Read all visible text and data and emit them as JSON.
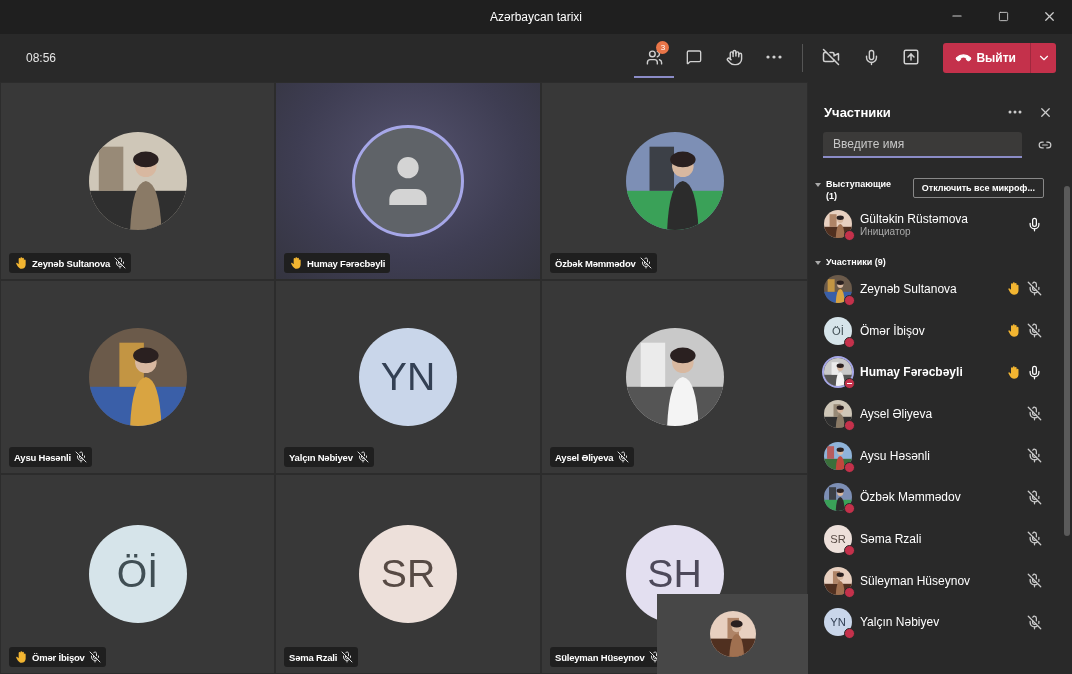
{
  "window": {
    "title": "Azərbaycan tarixi"
  },
  "toolbar": {
    "time": "08:56",
    "participants_badge": "3",
    "participants_selected": true,
    "leave_label": "Выйти"
  },
  "tiles": [
    {
      "name": "Zeynəb Sultanova",
      "hand_raised": true,
      "muted": true,
      "speaking": false
    },
    {
      "name": "Humay Fərəcbəyli",
      "avatar": {
        "kind": "default"
      },
      "hand_raised": true,
      "muted": false,
      "speaking": true
    },
    {
      "name": "Özbək Məmmədov",
      "hand_raised": false,
      "muted": true,
      "speaking": false
    },
    {
      "name": "Aysu Həsənli",
      "hand_raised": false,
      "muted": true,
      "speaking": false
    },
    {
      "name": "Yalçın Nəbiyev",
      "avatar": {
        "kind": "initials",
        "initials": "YN",
        "color": "#c9d6ea"
      },
      "hand_raised": false,
      "muted": true,
      "speaking": false
    },
    {
      "name": "Aysel Əliyeva",
      "hand_raised": false,
      "muted": true,
      "speaking": false
    },
    {
      "name": "Ömər İbişov",
      "avatar": {
        "kind": "initials",
        "initials": "Öİ",
        "color": "#d6e4ea"
      },
      "hand_raised": true,
      "muted": true,
      "speaking": false
    },
    {
      "name": "Səma Rzali",
      "avatar": {
        "kind": "initials",
        "initials": "SR",
        "color": "#ede0da"
      },
      "hand_raised": false,
      "muted": true,
      "speaking": false
    },
    {
      "name": "Süleyman Hüseynov",
      "avatar": {
        "kind": "initials",
        "initials": "SH",
        "color": "#e3dff0"
      },
      "hand_raised": false,
      "muted": true,
      "speaking": false
    }
  ],
  "panel": {
    "title": "Участники",
    "search": {
      "placeholder": "Введите имя"
    },
    "presenters": {
      "heading": "Выступающие (1)",
      "expanded": true,
      "mute_all": "Отключить все микроф...",
      "items": [
        {
          "name": "Gültəkin Rüstəmova",
          "role": "Инициатор",
          "do_not_disturb": false,
          "hand_raised": false,
          "muted": false,
          "speaking": false
        }
      ]
    },
    "attendees": {
      "heading": "Участники (9)",
      "expanded": true,
      "items": [
        {
          "name": "Zeynəb Sultanova",
          "do_not_disturb": false,
          "hand_raised": true,
          "muted": true,
          "speaking": false
        },
        {
          "name": "Ömər İbişov",
          "avatar": {
            "kind": "initials",
            "initials": "Öİ",
            "color": "#d6e4ea"
          },
          "do_not_disturb": false,
          "hand_raised": true,
          "muted": true,
          "speaking": false
        },
        {
          "name": "Humay Fərəcbəyli",
          "do_not_disturb": true,
          "hand_raised": true,
          "muted": false,
          "speaking": true
        },
        {
          "name": "Aysel Əliyeva",
          "do_not_disturb": false,
          "hand_raised": false,
          "muted": true,
          "speaking": false
        },
        {
          "name": "Aysu Həsənli",
          "do_not_disturb": false,
          "hand_raised": false,
          "muted": true,
          "speaking": false
        },
        {
          "name": "Özbək Məmmədov",
          "do_not_disturb": false,
          "hand_raised": false,
          "muted": true,
          "speaking": false
        },
        {
          "name": "Səma Rzali",
          "avatar": {
            "kind": "initials",
            "initials": "SR",
            "color": "#ede0da"
          },
          "do_not_disturb": false,
          "hand_raised": false,
          "muted": true,
          "speaking": false
        },
        {
          "name": "Süleyman Hüseynov",
          "do_not_disturb": false,
          "hand_raised": false,
          "muted": true,
          "speaking": false
        },
        {
          "name": "Yalçın Nəbiyev",
          "avatar": {
            "kind": "initials",
            "initials": "YN",
            "color": "#c9d6ea"
          },
          "do_not_disturb": false,
          "hand_raised": false,
          "muted": true,
          "speaking": false
        }
      ]
    }
  }
}
